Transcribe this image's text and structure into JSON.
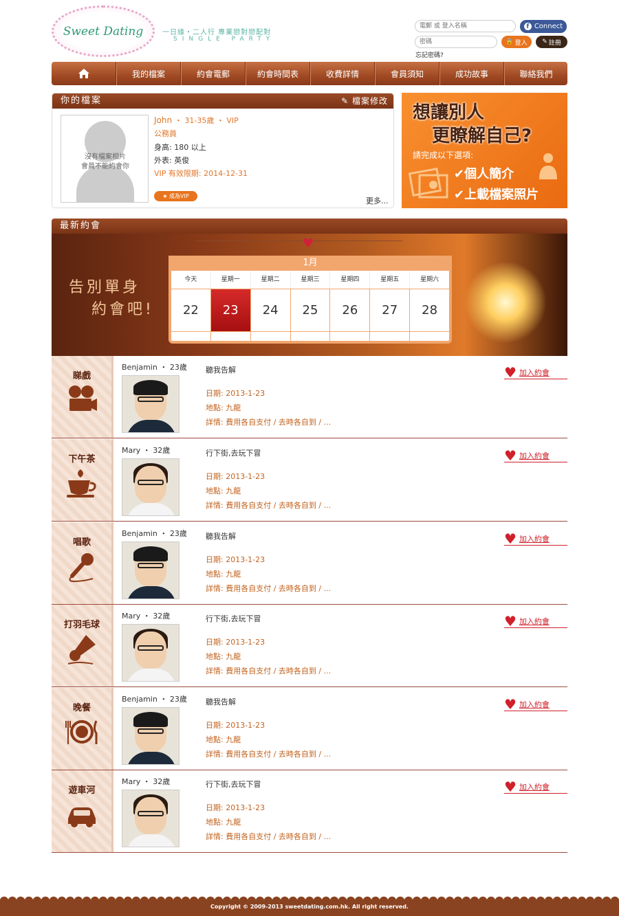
{
  "header": {
    "logo_text": "Sweet Dating",
    "tagline": "一日緣・二人行   專業戀對戀配對",
    "tagline_en": "SINGLE PARTY"
  },
  "login": {
    "username_placeholder": "電郵 或 登入名稱",
    "password_placeholder": "密碼",
    "fb_label": "Connect",
    "login_label": "登入",
    "register_label": "註冊",
    "forgot_label": "忘記密碼?"
  },
  "nav": {
    "home_icon": "home-icon",
    "items": [
      {
        "label": "我的檔案"
      },
      {
        "label": "約會電郵"
      },
      {
        "label": "約會時間表"
      },
      {
        "label": "收費詳情"
      },
      {
        "label": "會員須知"
      },
      {
        "label": "成功故事"
      },
      {
        "label": "聯絡我們"
      }
    ]
  },
  "profile": {
    "title": "你的檔案",
    "edit_label": "檔案修改",
    "no_photo_line1": "沒有檔案相片",
    "no_photo_line2": "會員不能約會你",
    "name": "John",
    "age_vip": "・ 31-35歲 ・ VIP",
    "occupation": "公務員",
    "height": "身高: 180 以上",
    "appearance": "外表: 英俊",
    "vip_expiry": "VIP 有效限期: 2014-12-31",
    "become_vip": "★ 成為VIP",
    "more": "更多..."
  },
  "promo": {
    "line1": "想讓別人",
    "line2": "更瞭解自己?",
    "line3": "請完成以下選項:",
    "line4": "✔個人簡介",
    "line5": "✔上載檔案照片"
  },
  "dates": {
    "title": "最新約會",
    "slogan1": "告別單身",
    "slogan2": "約會吧!",
    "month": "1月",
    "weekdays": [
      "今天",
      "星期一",
      "星期二",
      "星期三",
      "星期四",
      "星期五",
      "星期六"
    ],
    "days": [
      "22",
      "23",
      "24",
      "25",
      "26",
      "27",
      "28"
    ],
    "selected_day": "23",
    "join_label": "加入約會",
    "rows": [
      {
        "category": "睇戲",
        "icon": "film-camera-icon",
        "person": "Benjamin",
        "age": "・ 23歲",
        "title": "聽我告解",
        "date": "日期: 2013-1-23",
        "place": "地點: 九龍",
        "detail": "詳情: 費用各自支付 / 去時各自到 / ..."
      },
      {
        "category": "下午茶",
        "icon": "teacup-icon",
        "person": "Mary",
        "age": "・ 32歲",
        "title": "行下街,去玩下冒",
        "date": "日期: 2013-1-23",
        "place": "地點: 九龍",
        "detail": "詳情: 費用各自支付 / 去時各自到 / ..."
      },
      {
        "category": "唱歌",
        "icon": "microphone-icon",
        "person": "Benjamin",
        "age": "・ 23歲",
        "title": "聽我告解",
        "date": "日期: 2013-1-23",
        "place": "地點: 九龍",
        "detail": "詳情: 費用各自支付 / 去時各自到 / ..."
      },
      {
        "category": "打羽毛球",
        "icon": "shuttlecock-icon",
        "person": "Mary",
        "age": "・ 32歲",
        "title": "行下街,去玩下冒",
        "date": "日期: 2013-1-23",
        "place": "地點: 九龍",
        "detail": "詳情: 費用各自支付 / 去時各自到 / ..."
      },
      {
        "category": "晚餐",
        "icon": "dinner-plate-icon",
        "person": "Benjamin",
        "age": "・ 23歲",
        "title": "聽我告解",
        "date": "日期: 2013-1-23",
        "place": "地點: 九龍",
        "detail": "詳情: 費用各自支付 / 去時各自到 / ..."
      },
      {
        "category": "遊車河",
        "icon": "car-icon",
        "person": "Mary",
        "age": "・ 32歲",
        "title": "行下街,去玩下冒",
        "date": "日期: 2013-1-23",
        "place": "地點: 九龍",
        "detail": "詳情: 費用各自支付 / 去時各自到 / ..."
      }
    ]
  },
  "footer": {
    "copyright": "Copyright © 2009-2013 sweetdating.com.hk. All right reserved."
  },
  "colors": {
    "brand_brown": "#8a4320",
    "accent_orange": "#e8741e",
    "selected_red": "#c0181a"
  }
}
